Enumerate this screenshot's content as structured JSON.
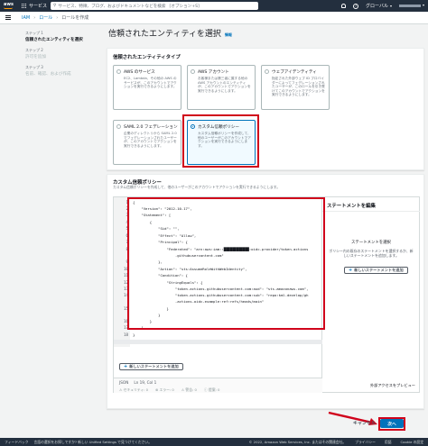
{
  "topnav": {
    "logo_text": "aws",
    "services_label": "サービス",
    "search_placeholder": "サービス、特徴、ブログ、およびドキュメントなどを検索",
    "search_shortcut": "[オプション+S]",
    "region": "グローバル"
  },
  "breadcrumb": {
    "items": [
      "IAM",
      "ロール",
      "ロールを作成"
    ]
  },
  "steps": [
    {
      "num": "ステップ 1",
      "title": "信頼されたエンティティを選択",
      "state": "active"
    },
    {
      "num": "ステップ 2",
      "title": "許可を追加",
      "state": "inactive"
    },
    {
      "num": "ステップ 3",
      "title": "名前、確認、および作成",
      "state": "inactive"
    }
  ],
  "page": {
    "title": "信頼されたエンティティを選択",
    "info_link": "情報"
  },
  "entity_type": {
    "title": "信頼されたエンティティタイプ",
    "tiles": [
      {
        "name": "AWS のサービス",
        "desc": "EC2、Lambda、その他の AWS のサービスが、このアカウントでアクションを実行できるようにします。",
        "selected": false
      },
      {
        "name": "AWS アカウント",
        "desc": "お客様または第三者に属する他の AWS アカウントのエンティティが、このアカウントでアクションを実行できるようにします。",
        "selected": false
      },
      {
        "name": "ウェブアイデンティティ",
        "desc": "指定された外部ウェブ ID プロバイダーによってフェデレーションされたユーザーが、このロールを引き受けてこのアカウントでアクションを実行できるようにします。",
        "selected": false
      },
      {
        "name": "SAML 2.0 フェデレーション",
        "desc": "企業のディレクトリから SAML 2.0 でフェデレーションされたユーザーが、このアカウントでアクションを実行できるようにします。",
        "selected": false
      },
      {
        "name": "カスタム信頼ポリシー",
        "desc": "カスタム信頼ポリシーを作成して、他のユーザーがこのアカウントでアクションを実行できるようにします。",
        "selected": true
      }
    ]
  },
  "custom_policy": {
    "title": "カスタム信頼ポリシー",
    "subtitle": "カスタム信頼ポリシーを作成して、他のユーザーがこのアカウントでアクションを実行できるようにします。",
    "line_numbers": [
      "1",
      "2",
      "3",
      "4",
      "5",
      "6",
      "7",
      "8",
      "9",
      "10",
      "11",
      "12",
      "13",
      "14",
      "15",
      "16",
      "17",
      "18",
      "19"
    ],
    "current_line": "19",
    "code_lines": [
      "{",
      "    \"Version\": \"2012-10-17\",",
      "    \"Statement\": [",
      "        {",
      "            \"Sid\": \"\",",
      "            \"Effect\": \"Allow\",",
      "            \"Principal\": {",
      "                \"Federated\": \"arn:aws:iam::████████████:oidc-provider/token.actions",
      "                    .githubusercontent.com\"",
      "            },",
      "            \"Action\": \"sts:AssumeRoleWithWebIdentity\",",
      "            \"Condition\": {",
      "                \"StringEquals\": {",
      "                    \"token.actions.githubusercontent.com:aud\": \"sts.amazonaws.com\",",
      "                    \"token.actions.githubusercontent.com:sub\": \"repo:kml-develop/gh",
      "                    -actions-oidc-example:ref:refs/heads/main\"",
      "                }",
      "            }",
      "        }",
      "    ]",
      "}"
    ],
    "add_statement_label": "新しいステートメントを追加",
    "status_lang": "JSON",
    "status_pos": "Ln 19, Col 1",
    "status_security": "セキュリティ: 0",
    "status_errors": "エラー: 0",
    "status_warnings": "警告: 0",
    "status_suggestions": "提案: 0"
  },
  "statement_panel": {
    "title": "ステートメントを編集",
    "heading": "ステートメントを選択",
    "desc": "ポリシー内の既存のステートメントを選択するか、新しいステートメントを追加します。",
    "button": "新しいステートメントを追加",
    "footer": "外部アクセスをプレビュー"
  },
  "actions": {
    "cancel": "キャンセル",
    "next": "次へ"
  },
  "footer": {
    "feedback": "フィードバック",
    "lang_note": "言語の選択をお探しですか? 新しい Unified Settings で見つけてください。",
    "copyright": "© 2022, Amazon Web Services, Inc. またはその関連会社。",
    "privacy": "プライバシー",
    "terms": "用語",
    "cookie": "Cookie の設定"
  },
  "colors": {
    "nav_bg": "#232f3e",
    "accent": "#0073bb",
    "highlight": "#d0021b",
    "aws_orange": "#ff9900"
  }
}
